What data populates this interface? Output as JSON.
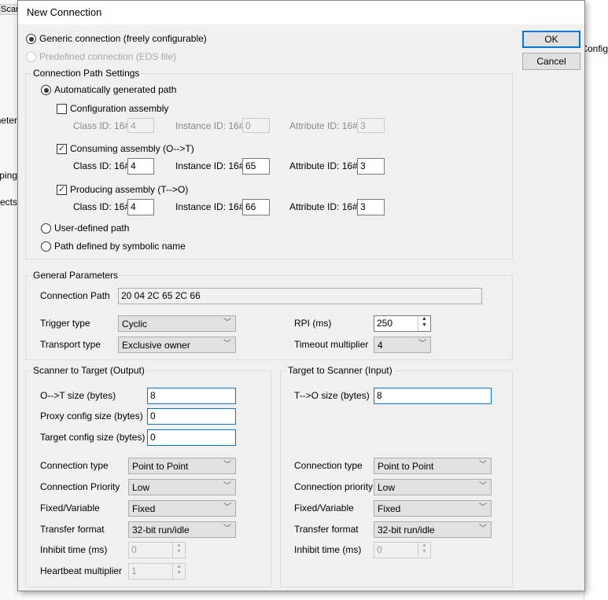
{
  "background": {
    "left_texts": [
      "Scan",
      "meter",
      "pping",
      "ects"
    ],
    "right_text": "Config"
  },
  "dialog": {
    "title": "New Connection",
    "ok": "OK",
    "cancel": "Cancel",
    "generic": "Generic connection (freely configurable)",
    "predefined": "Predefined connection (EDS file)",
    "path_settings": {
      "legend": "Connection Path Settings",
      "auto": "Automatically generated path",
      "config_assembly": {
        "label": "Configuration assembly",
        "checked": false,
        "class_id": "4",
        "instance_id": "0",
        "attribute_id": "3"
      },
      "consuming": {
        "label": "Consuming assembly (O-->T)",
        "checked": true,
        "class_id": "4",
        "instance_id": "65",
        "attribute_id": "3"
      },
      "producing": {
        "label": "Producing assembly (T-->O)",
        "checked": true,
        "class_id": "4",
        "instance_id": "66",
        "attribute_id": "3"
      },
      "class_label": "Class ID: 16#",
      "instance_label": "Instance ID: 16#",
      "attribute_label": "Attribute ID: 16#",
      "user_defined": "User-defined path",
      "symbolic": "Path defined by symbolic name"
    },
    "general": {
      "legend": "General Parameters",
      "conn_path_label": "Connection Path",
      "conn_path": "20 04 2C 65 2C 66",
      "trigger_label": "Trigger type",
      "trigger": "Cyclic",
      "transport_label": "Transport type",
      "transport": "Exclusive owner",
      "rpi_label": "RPI (ms)",
      "rpi": "250",
      "timeout_label": "Timeout multiplier",
      "timeout": "4"
    },
    "output": {
      "legend": "Scanner to Target (Output)",
      "size_label": "O-->T size (bytes)",
      "size": "8",
      "proxy_label": "Proxy config size (bytes)",
      "proxy": "0",
      "target_label": "Target config size (bytes)",
      "target": "0",
      "conn_type_label": "Connection type",
      "conn_type": "Point to Point",
      "priority_label": "Connection Priority",
      "priority": "Low",
      "fixed_label": "Fixed/Variable",
      "fixed": "Fixed",
      "format_label": "Transfer format",
      "format": "32-bit run/idle",
      "inhibit_label": "Inhibit time (ms)",
      "inhibit": "0",
      "heartbeat_label": "Heartbeat multiplier",
      "heartbeat": "1"
    },
    "input": {
      "legend": "Target to Scanner (Input)",
      "size_label": "T-->O size (bytes)",
      "size": "8",
      "conn_type_label": "Connection type",
      "conn_type": "Point to Point",
      "priority_label": "Connection priority",
      "priority": "Low",
      "fixed_label": "Fixed/Variable",
      "fixed": "Fixed",
      "format_label": "Transfer format",
      "format": "32-bit run/idle",
      "inhibit_label": "Inhibit time (ms)",
      "inhibit": "0"
    }
  }
}
